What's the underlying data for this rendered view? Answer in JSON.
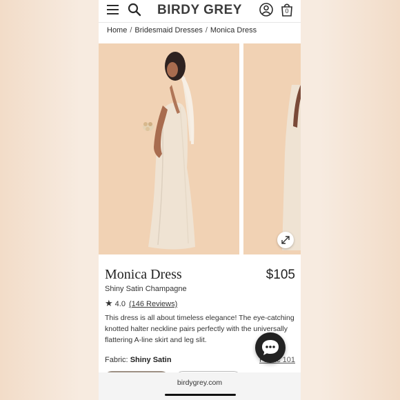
{
  "header": {
    "brand": "BIRDY GREY",
    "icons": [
      "menu-icon",
      "search-icon",
      "account-icon",
      "bag-icon"
    ],
    "bag_count": "0"
  },
  "breadcrumb": [
    "Home",
    "Bridesmaid Dresses",
    "Monica Dress"
  ],
  "product": {
    "name": "Monica Dress",
    "price": "$105",
    "color": "Shiny Satin Champagne",
    "rating": "4.0",
    "reviews": "(146 Reviews)",
    "description": "This dress is all about timeless elegance! The eye-catching knotted halter neckline pairs perfectly with the universally flattering A-line skirt and leg slit.",
    "fabric_label": "Fabric:",
    "fabric_value": "Shiny Satin",
    "fabric_link": "Fabric 101"
  },
  "browser": {
    "domain": "birdygrey.com"
  },
  "colors": {
    "photo_bg": "#f1d2b4",
    "dress": "#efe3d3",
    "text": "#222222"
  }
}
